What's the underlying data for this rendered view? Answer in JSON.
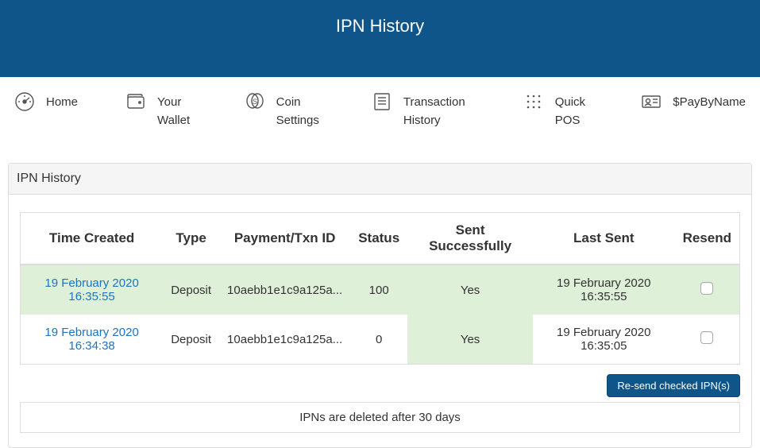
{
  "header": {
    "title": "IPN History"
  },
  "nav": {
    "home": "Home",
    "wallet": "Your Wallet",
    "coin": "Coin Settings",
    "txhist1": "Transaction History",
    "quickpos": "Quick POS",
    "paybyname": "$PayByName"
  },
  "panel": {
    "title": "IPN History"
  },
  "columns": {
    "time": "Time Created",
    "type": "Type",
    "txid": "Payment/Txn ID",
    "status": "Status",
    "sent": "Sent Successfully",
    "last": "Last Sent",
    "resend": "Resend"
  },
  "rows": [
    {
      "time": "19 February 2020 16:35:55",
      "type": "Deposit",
      "txid": "10aebb1e1c9a125a...",
      "status": "100",
      "sent": "Yes",
      "last": "19 February 2020 16:35:55"
    },
    {
      "time": "19 February 2020 16:34:38",
      "type": "Deposit",
      "txid": "10aebb1e1c9a125a...",
      "status": "0",
      "sent": "Yes",
      "last": "19 February 2020 16:35:05"
    }
  ],
  "actions": {
    "resend_button": "Re-send checked IPN(s)"
  },
  "footer": {
    "note": "IPNs are deleted after 30 days"
  }
}
